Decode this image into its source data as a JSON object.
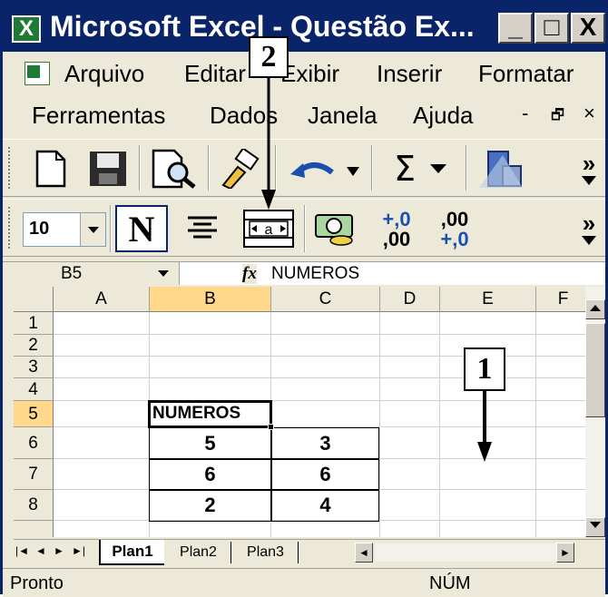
{
  "window": {
    "title": "Microsoft Excel - Questão Ex...",
    "app_icon_letter": "X",
    "minimize_label": "_",
    "restore_label": "□",
    "close_label": "X"
  },
  "menu": {
    "row1": [
      "Arquivo",
      "Editar",
      "Exibir",
      "Inserir",
      "Formatar"
    ],
    "row2": [
      "Ferramentas",
      "Dados",
      "Janela",
      "Ajuda"
    ],
    "doc_min": "-",
    "doc_restore": "🗗",
    "doc_close": "×"
  },
  "toolbar_standard": {
    "icons": [
      "new-document-icon",
      "save-icon",
      "print-preview-icon",
      "format-painter-icon",
      "undo-icon",
      "autosum-icon",
      "chart-wizard-icon"
    ],
    "autosum_glyph": "Σ",
    "overflow": "»"
  },
  "toolbar_format": {
    "font_size": "10",
    "bold_label": "N",
    "increase_decimal_top": "+,0",
    "increase_decimal_bottom": ",00",
    "decrease_decimal_top": ",00",
    "decrease_decimal_bottom": "+,0",
    "merge_center_glyph": "a",
    "overflow": "»"
  },
  "formula_bar": {
    "name_box": "B5",
    "fx_label": "fx",
    "content": "NUMEROS"
  },
  "sheet": {
    "columns": [
      "A",
      "B",
      "C",
      "D",
      "E",
      "F"
    ],
    "rows": [
      "1",
      "2",
      "3",
      "4",
      "5",
      "6",
      "7",
      "8"
    ],
    "cells": {
      "B5": "NUMEROS",
      "B6": "5",
      "C6": "3",
      "B7": "6",
      "C7": "6",
      "B8": "2",
      "C8": "4"
    }
  },
  "tabs": {
    "nav": [
      "|◄",
      "◄",
      "►",
      "►|"
    ],
    "sheets": [
      "Plan1",
      "Plan2",
      "Plan3"
    ],
    "active": "Plan1"
  },
  "status": {
    "left": "Pronto",
    "num": "NÚM"
  },
  "annotations": {
    "callout1": "1",
    "callout2": "2"
  }
}
